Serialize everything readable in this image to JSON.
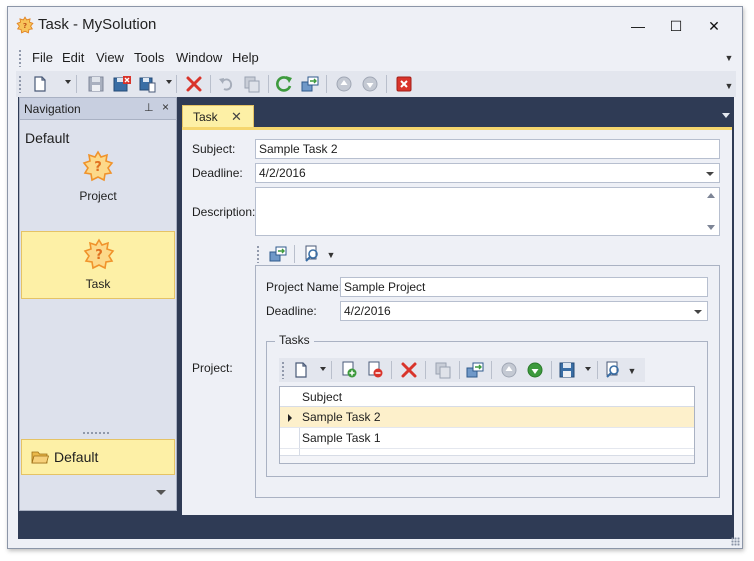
{
  "window": {
    "title": "Task - MySolution",
    "controls": {
      "minimize": "—",
      "maximize": "☐",
      "close": "✕"
    }
  },
  "menu": {
    "items": [
      "File",
      "Edit",
      "View",
      "Tools",
      "Window",
      "Help"
    ]
  },
  "toolbar": {
    "buttons": [
      "new-icon",
      "save-icon",
      "save-and-close-icon",
      "save-and-new-icon",
      "delete-icon",
      "undo-icon",
      "clone-icon",
      "refresh-icon",
      "link-icon",
      "previous-icon",
      "next-icon",
      "close-view-icon"
    ]
  },
  "navigation": {
    "title": "Navigation",
    "pin_glyph": "📌",
    "close_glyph": "×",
    "group_title": "Default",
    "items": [
      {
        "label": "Project",
        "selected": false
      },
      {
        "label": "Task",
        "selected": true
      }
    ],
    "group_button": "Default"
  },
  "document": {
    "tab_label": "Task",
    "tab_close": "✕"
  },
  "task": {
    "subject_label": "Subject:",
    "subject_value": "Sample Task 2",
    "deadline_label": "Deadline:",
    "deadline_value": "4/2/2016",
    "description_label": "Description:",
    "description_value": "",
    "project_label": "Project:"
  },
  "project": {
    "name_label": "Project Name:",
    "name_value": "Sample Project",
    "deadline_label": "Deadline:",
    "deadline_value": "4/2/2016",
    "tasks_caption": "Tasks"
  },
  "tasks_grid": {
    "column": "Subject",
    "rows": [
      {
        "subject": "Sample Task 2",
        "focused": true
      },
      {
        "subject": "Sample Task 1",
        "focused": false
      }
    ]
  },
  "colors": {
    "accent_yellow": "#fdf0a6",
    "dark_client": "#2f3b55",
    "delete_red": "#d9342b",
    "refresh_green": "#3d9a3d",
    "icon_blue": "#3a6ea5",
    "gear_orange": "#f0932b"
  }
}
